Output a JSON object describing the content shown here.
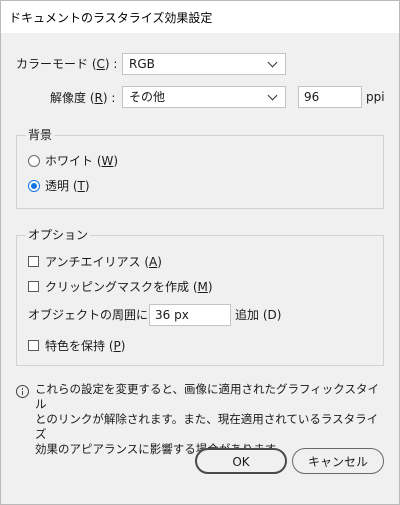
{
  "window": {
    "title": "ドキュメントのラスタライズ効果設定"
  },
  "color_mode": {
    "label": "カラーモード",
    "hotkey": "C",
    "value": "RGB"
  },
  "resolution": {
    "label": "解像度",
    "hotkey": "R",
    "value": "その他",
    "ppi_value": "96",
    "unit": "ppi"
  },
  "background": {
    "title": "背景",
    "options": [
      {
        "label": "ホワイト",
        "hotkey": "W",
        "selected": false
      },
      {
        "label": "透明",
        "hotkey": "T",
        "selected": true
      }
    ]
  },
  "options": {
    "title": "オプション",
    "antialias": {
      "label": "アンチエイリアス",
      "hotkey": "A",
      "checked": false
    },
    "clipping_mask": {
      "label": "クリッピングマスクを作成",
      "hotkey": "M",
      "checked": false
    },
    "padding": {
      "label": "オブジェクトの周囲に",
      "value": "36 px",
      "suffix": "追加 (D)"
    },
    "spot_colors": {
      "label": "特色を保持",
      "hotkey": "P",
      "checked": false
    }
  },
  "info": {
    "lines": [
      "これらの設定を変更すると、画像に適用されたグラフィックスタイル",
      "とのリンクが解除されます。また、現在適用されているラスタライズ",
      "効果のアピアランスに影響する場合があります。"
    ]
  },
  "buttons": {
    "ok": "OK",
    "cancel": "キャンセル"
  },
  "colors": {
    "accent": "#1473e6",
    "background": "#f0f0f0"
  }
}
